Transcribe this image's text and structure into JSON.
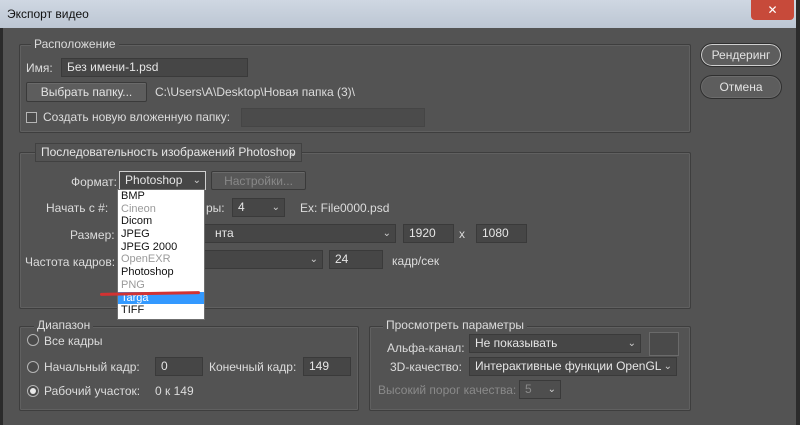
{
  "window": {
    "title": "Экспорт видео",
    "close_glyph": "✕"
  },
  "location": {
    "legend": "Расположение",
    "name_label": "Имя:",
    "name_value": "Без имени-1.psd",
    "choose_folder_button": "Выбрать папку...",
    "path": "C:\\Users\\A\\Desktop\\Новая папка (3)\\",
    "create_subfolder_label": "Создать новую вложенную папку:",
    "subfolder_value": ""
  },
  "actions": {
    "render_button": "Рендеринг",
    "cancel_button": "Отмена"
  },
  "sequence": {
    "type_select": "Последовательность изображений Photoshop",
    "format_label": "Формат:",
    "format_value": "Photoshop",
    "settings_button": "Настройки...",
    "start_label": "Начать с #:",
    "digits_label_partial": "ры:",
    "digits_value": "4",
    "example": "Ex: File0000.psd",
    "size_label": "Размер:",
    "size_value_partial": "нта",
    "width": "1920",
    "x_sep": "x",
    "height": "1080",
    "fps_label": "Частота кадров:",
    "fps_value": "24",
    "fps_unit": "кадр/сек"
  },
  "format_dropdown": {
    "options": [
      {
        "label": "BMP",
        "state": "normal"
      },
      {
        "label": "Cineon",
        "state": "disabled"
      },
      {
        "label": "Dicom",
        "state": "normal"
      },
      {
        "label": "JPEG",
        "state": "normal"
      },
      {
        "label": "JPEG 2000",
        "state": "normal"
      },
      {
        "label": "OpenEXR",
        "state": "disabled"
      },
      {
        "label": "Photoshop",
        "state": "normal"
      },
      {
        "label": "PNG",
        "state": "disabled"
      },
      {
        "label": "Targa",
        "state": "selected"
      },
      {
        "label": "TIFF",
        "state": "normal"
      }
    ]
  },
  "range": {
    "legend": "Диапазон",
    "all_frames": "Все кадры",
    "start_frame_label": "Начальный кадр:",
    "start_frame_value": "0",
    "end_frame_label": "Конечный кадр:",
    "end_frame_value": "149",
    "work_area_label": "Рабочий участок:",
    "work_area_value": "0 к 149"
  },
  "preview": {
    "legend": "Просмотреть параметры",
    "alpha_label": "Альфа-канал:",
    "alpha_value": "Не показывать",
    "quality_label": "3D-качество:",
    "quality_value": "Интерактивные функции OpenGL",
    "threshold_label": "Высокий порог качества:",
    "threshold_value": "5"
  },
  "colors": {
    "panel": "#535353",
    "selection": "#3399ff",
    "annotation": "#d23232",
    "close": "#c74a3a"
  }
}
